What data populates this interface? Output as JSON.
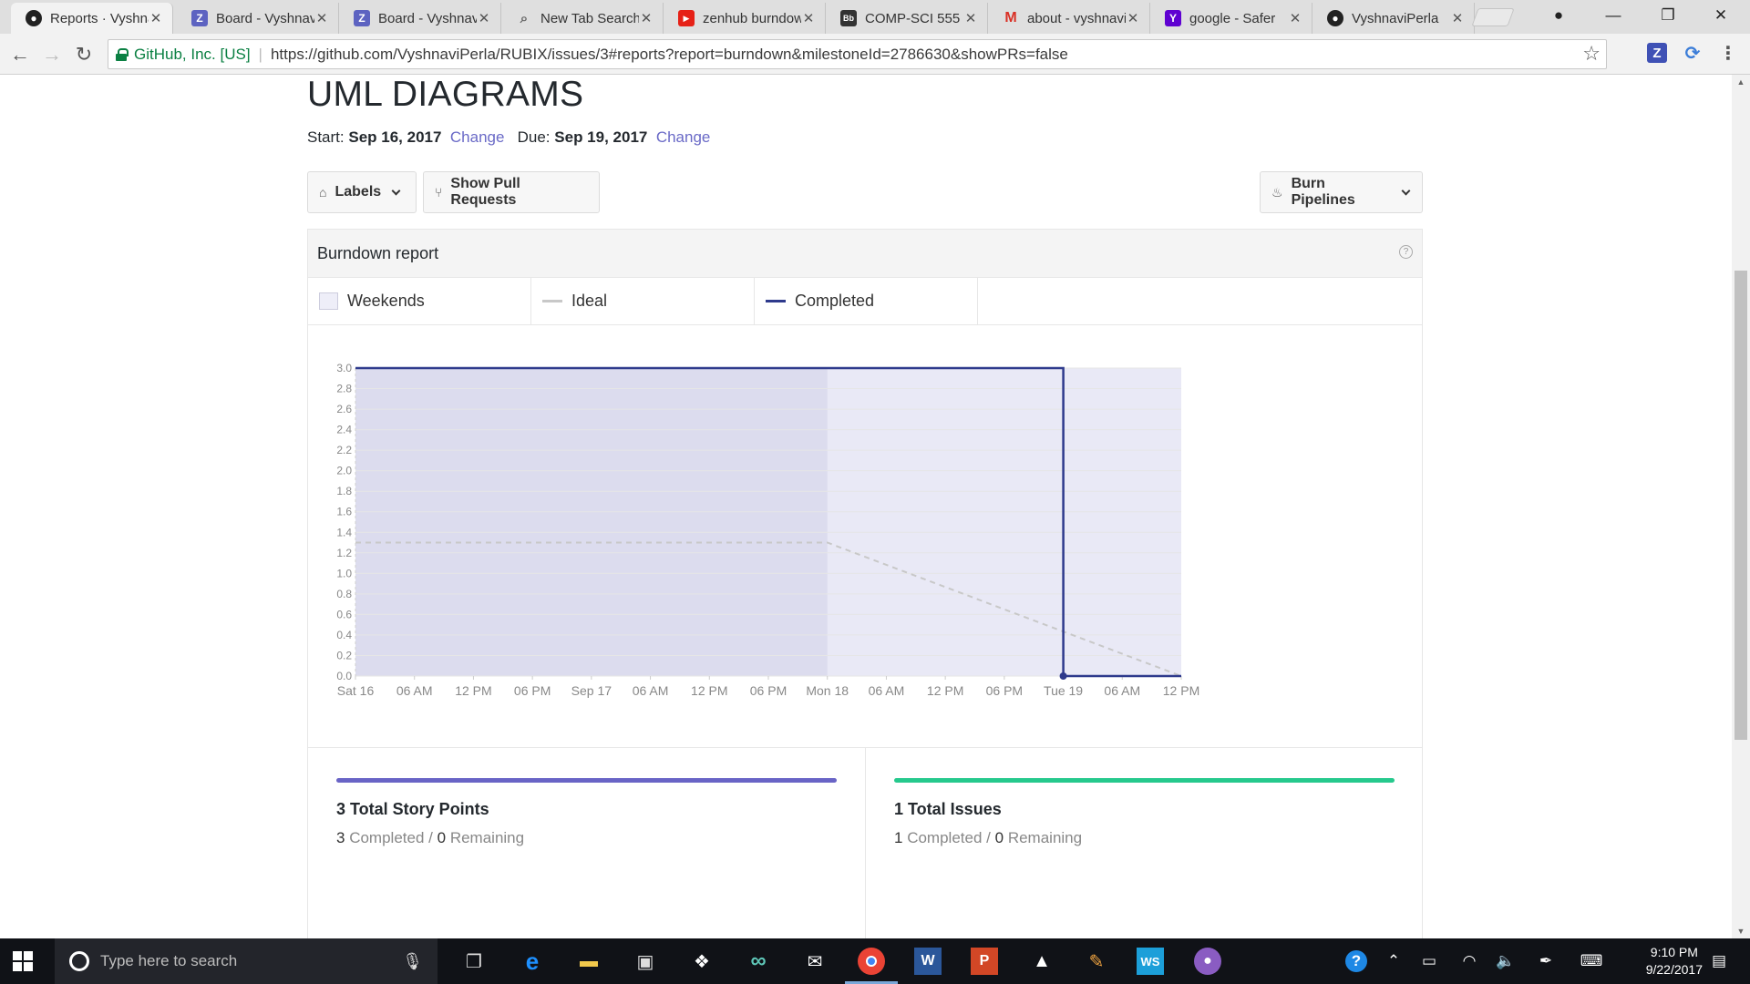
{
  "browser": {
    "tabs": [
      {
        "title": "Reports · Vyshnavi",
        "icon": "github-icon",
        "active": true
      },
      {
        "title": "Board - Vyshnavi",
        "icon": "zenhub-icon",
        "active": false
      },
      {
        "title": "Board - Vyshnavi",
        "icon": "zenhub-icon",
        "active": false
      },
      {
        "title": "New Tab Search",
        "icon": "search-icon",
        "active": false
      },
      {
        "title": "zenhub burndown",
        "icon": "youtube-icon",
        "active": false
      },
      {
        "title": "COMP-SCI 555",
        "icon": "blackboard-icon",
        "active": false
      },
      {
        "title": "about - vyshnavi",
        "icon": "gmail-icon",
        "active": false
      },
      {
        "title": "google - Safer",
        "icon": "yahoo-icon",
        "active": false
      },
      {
        "title": "VyshnaviPerla",
        "icon": "github-icon",
        "active": false
      }
    ],
    "security_label": "GitHub, Inc. [US]",
    "url": "https://github.com/VyshnaviPerla/RUBIX/issues/3#reports?report=burndown&milestoneId=2786630&showPRs=false"
  },
  "page": {
    "title": "UML DIAGRAMS",
    "start_label": "Start:",
    "start_date": "Sep 16, 2017",
    "change_label": "Change",
    "due_label": "Due:",
    "due_date": "Sep 19, 2017",
    "labels_button": "Labels",
    "show_prs_button": "Show Pull Requests",
    "burn_pipelines_button": "Burn Pipelines"
  },
  "report": {
    "title": "Burndown report",
    "help": "?",
    "legend": {
      "weekends": "Weekends",
      "ideal": "Ideal",
      "completed": "Completed"
    },
    "colors": {
      "weekend_fill": "#e9e9f6",
      "weekend_dark_fill": "#dcdcee",
      "ideal": "#c8c8c8",
      "completed": "#2e3a8c",
      "story_bar": "#6964c6",
      "issues_bar": "#26c98d"
    }
  },
  "chart_data": {
    "type": "line",
    "x_tick_labels": [
      "Sat 16",
      "06 AM",
      "12 PM",
      "06 PM",
      "Sep 17",
      "06 AM",
      "12 PM",
      "06 PM",
      "Mon 18",
      "06 AM",
      "12 PM",
      "06 PM",
      "Tue 19",
      "06 AM",
      "12 PM"
    ],
    "y_tick_labels": [
      "0.0",
      "0.2",
      "0.4",
      "0.6",
      "0.8",
      "1.0",
      "1.2",
      "1.4",
      "1.6",
      "1.8",
      "2.0",
      "2.2",
      "2.4",
      "2.6",
      "2.8",
      "3.0"
    ],
    "xlim_hours": [
      0,
      84
    ],
    "ylim": [
      0,
      3.0
    ],
    "weekend_band_hours": [
      0,
      48
    ],
    "series": [
      {
        "name": "Ideal",
        "points": [
          [
            0,
            1.3
          ],
          [
            48,
            1.3
          ],
          [
            84,
            0.0
          ]
        ]
      },
      {
        "name": "Completed",
        "points": [
          [
            0,
            3.0
          ],
          [
            72,
            3.0
          ],
          [
            72,
            0.0
          ],
          [
            84,
            0.0
          ]
        ]
      }
    ],
    "grid": true
  },
  "stats": {
    "story_points": {
      "total": "3 Total Story Points",
      "completed_num": "3",
      "completed_label": "Completed",
      "divider": "/",
      "remaining_num": "0",
      "remaining_label": "Remaining"
    },
    "issues": {
      "total": "1 Total Issues",
      "completed_num": "1",
      "completed_label": "Completed",
      "divider": "/",
      "remaining_num": "0",
      "remaining_label": "Remaining"
    }
  },
  "taskbar": {
    "search_placeholder": "Type here to search",
    "time": "9:10 PM",
    "date": "9/22/2017",
    "apps": [
      "task-view-icon",
      "edge-icon",
      "file-explorer-icon",
      "store-icon",
      "dropbox-icon",
      "infinity-icon",
      "mail-icon",
      "chrome-icon",
      "word-icon",
      "powerpoint-icon",
      "photos-icon",
      "paint-icon",
      "webstorm-icon",
      "github-desktop-icon"
    ]
  }
}
